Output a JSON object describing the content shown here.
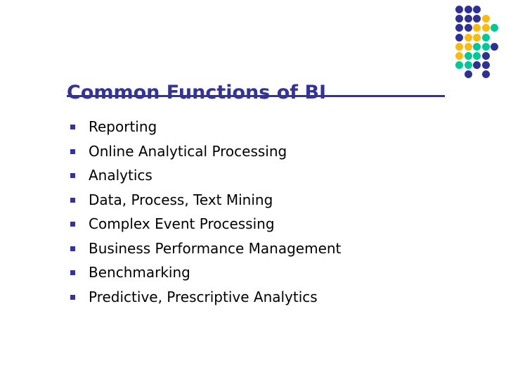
{
  "slide": {
    "title": "Common Functions of BI",
    "accent_color": "#333399",
    "body_text_color": "#000000",
    "background_color": "#ffffff",
    "bullets": [
      {
        "label": "Reporting"
      },
      {
        "label": "Online Analytical Processing"
      },
      {
        "label": "Analytics"
      },
      {
        "label": "Data, Process, Text Mining"
      },
      {
        "label": "Complex Event Processing"
      },
      {
        "label": "Business Performance Management"
      },
      {
        "label": "Benchmarking"
      },
      {
        "label": "Predictive, Prescriptive Analytics"
      }
    ]
  },
  "decoration": {
    "name": "dot-grid-logo",
    "palette": {
      "navy": "#2e3192",
      "gold": "#fdb913",
      "teal": "#00c896"
    },
    "cell_pitch_x": 12.6,
    "cell_pitch_y": 13.2,
    "rows": [
      [
        "navy",
        "navy",
        "navy",
        null,
        null
      ],
      [
        "navy",
        "navy",
        "navy",
        "gold",
        null
      ],
      [
        "navy",
        "navy",
        "gold",
        "gold",
        "teal"
      ],
      [
        "navy",
        "gold",
        "gold",
        "teal",
        null
      ],
      [
        "gold",
        "gold",
        "teal",
        "teal",
        "navy"
      ],
      [
        "gold",
        "teal",
        "teal",
        "navy",
        null
      ],
      [
        "teal",
        "teal",
        "navy",
        "navy",
        null
      ],
      [
        null,
        "navy",
        null,
        "navy",
        null
      ]
    ]
  }
}
